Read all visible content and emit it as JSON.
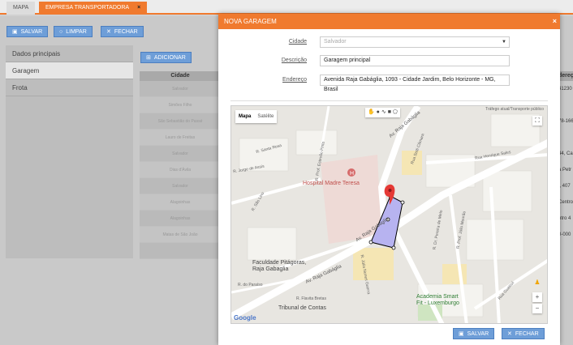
{
  "tabs": [
    {
      "label": "MAPA"
    },
    {
      "label": "EMPRESA TRANSPORTADORA",
      "close": "×"
    }
  ],
  "toolbar": {
    "save_label": "SALVAR",
    "clear_label": "LIMPAR",
    "close_label": "FECHAR"
  },
  "sidebar": {
    "items": [
      {
        "label": "Dados principais"
      },
      {
        "label": "Garagem"
      },
      {
        "label": "Frota"
      }
    ]
  },
  "grid": {
    "add_label": "ADICIONAR",
    "header": "Cidade",
    "rows": [
      "Salvador",
      "Simões Filho",
      "São Sebastião do Passé",
      "Lauro de Freitas",
      "Salvador",
      "Dias d'Ávila",
      "Salvador",
      "Alagoinhas",
      "Alagoinhas",
      "Matas de São João",
      ""
    ],
    "right_header": "dereço",
    "right_values": [
      "41230",
      "",
      "78-166",
      "",
      "44, Ca",
      "a Petr",
      "l, 407",
      "Centro",
      "ntro 4",
      "0-000",
      ""
    ]
  },
  "modal": {
    "title": "NOVA GARAGEM",
    "close": "×",
    "city_label": "Cidade",
    "city_value": "Salvador",
    "desc_label": "Descrição",
    "desc_value": "Garagem principal",
    "addr_label": "Endereço",
    "addr_value": "Avenida Raja Gabáglia, 1093 - Cidade Jardim, Belo Horizonte - MG, Brasil",
    "save_label": "SALVAR",
    "close_label": "FECHAR"
  },
  "map": {
    "tab_map": "Mapa",
    "tab_satellite": "Satélite",
    "attribution": "Tráfego atual/Transporte público",
    "google": "Google",
    "labels": {
      "hospital": "Hospital Madre Teresa",
      "faculdade": "Faculdade Pitágoras, Raja Gabaglia",
      "academia": "Academia Smart Fit - Luxemburgo",
      "tribunal": "Tribunal de Contas",
      "raja1": "Av. Raja Gabáglia",
      "raja2": "Av. Raja Gabáglia",
      "raja3": "Av. Raja Gabáglia",
      "ruaJulia": "R. Júlia Nunes Guerra",
      "ruaSanta": "R. Santa Rosa",
      "ruaJorge": "R. Jorge de Assis",
      "ruaProf": "R. Prof. Estevão Pinto",
      "ruaSantos": "R. São Lino",
      "ruaGuarda": "R. Guarda",
      "ruaSetti": "Rua Setti Câmara",
      "ruaHenrique": "Rua Henrique Sales",
      "ruaPereira": "R. Dr. Pereira de Melo",
      "ruaJulio": "R. Prof. Júlio Mourão",
      "ruaFlavita": "R. Flavita Bretas",
      "ruaParaiso": "R. do Paraíso",
      "ruaGuaicui": "Rua Guaicuí"
    },
    "accent_polygon": "#b7b3f0",
    "pin_color": "#e53935"
  },
  "colors": {
    "accent": "#f07a2e",
    "button": "#6e9ed8"
  }
}
